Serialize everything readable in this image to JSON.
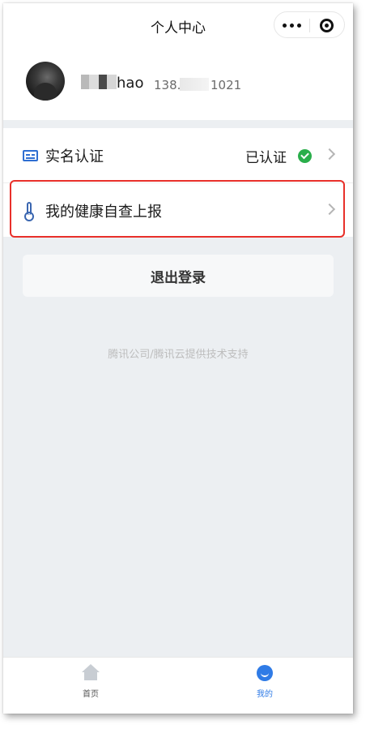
{
  "nav": {
    "title": "个人中心",
    "more_icon": "more-dots-icon",
    "close_icon": "target-close-icon"
  },
  "profile": {
    "name_visible": "hao",
    "phone_prefix": "138.",
    "phone_suffix": "1021"
  },
  "list": {
    "items": [
      {
        "label": "实名认证",
        "status": "已认证",
        "icon": "id-card-icon",
        "status_icon": "check-circle-icon"
      },
      {
        "label": "我的健康自查上报",
        "icon": "thermometer-icon"
      }
    ]
  },
  "actions": {
    "logout_label": "退出登录"
  },
  "footer": {
    "note": "腾讯公司/腾讯云提供技术支持"
  },
  "tabbar": {
    "tabs": [
      {
        "label": "首页",
        "icon": "home-icon",
        "active": false
      },
      {
        "label": "我的",
        "icon": "smile-user-icon",
        "active": true
      }
    ]
  },
  "colors": {
    "accent": "#2f7be6",
    "verified": "#2aae4b",
    "highlight": "#e8302a",
    "page_bg": "#eceff2"
  }
}
